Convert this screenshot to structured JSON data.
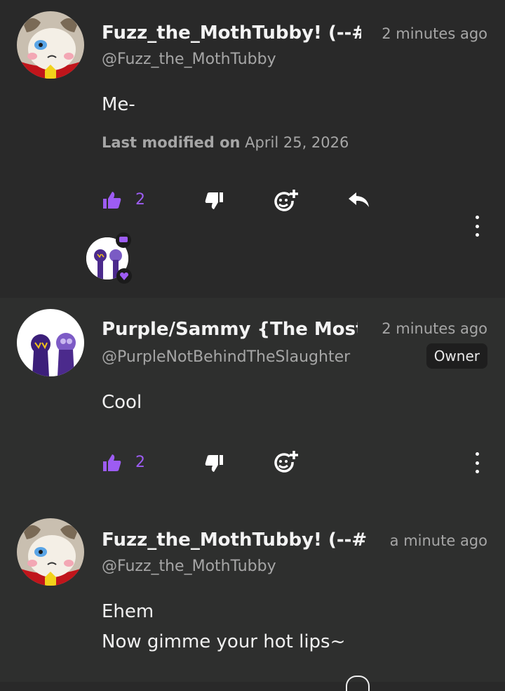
{
  "comments": [
    {
      "name": "Fuzz_the_MothTubby! (--#",
      "handle": "@Fuzz_the_MothTubby",
      "time": "2 minutes ago",
      "body": [
        "Me-"
      ],
      "modified_label": "Last modified on",
      "modified_date": "April 25, 2026",
      "likes": "2",
      "avatar_icon": "moth-character-avatar-icon"
    },
    {
      "name": "Purple/Sammy {The Most",
      "handle": "@PurpleNotBehindTheSlaughter",
      "time": "2 minutes ago",
      "badge": "Owner",
      "body": [
        "Cool"
      ],
      "likes": "2",
      "avatar_icon": "purple-characters-avatar-icon"
    },
    {
      "name": "Fuzz_the_MothTubby! (--#",
      "handle": "@Fuzz_the_MothTubby",
      "time": "a minute ago",
      "body": [
        "Ehem",
        "Now gimme your hot lips~"
      ],
      "avatar_icon": "moth-character-avatar-icon"
    }
  ],
  "colors": {
    "accent": "#9d5cf3",
    "background": "#292929",
    "muted_text": "#a6a6a6"
  }
}
